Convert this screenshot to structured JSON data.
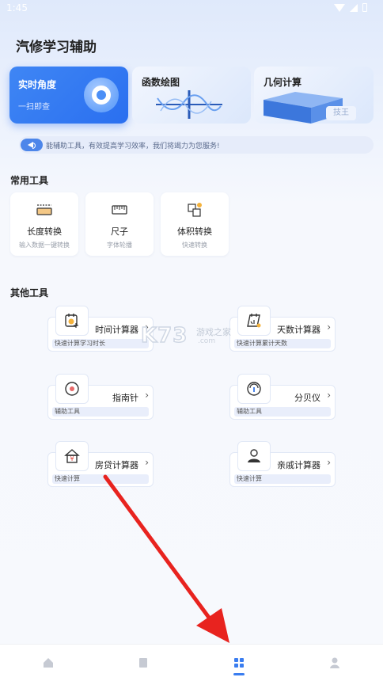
{
  "status_bar": {
    "time": "1:45"
  },
  "app": {
    "title": "汽修学习辅助"
  },
  "feature_cards": [
    {
      "title": "实时角度",
      "subtitle": "一扫即查"
    },
    {
      "title": "函数绘图"
    },
    {
      "title": "几何计算",
      "badge": "技王"
    }
  ],
  "notice": {
    "text": "能辅助工具，有效提高学习效率，我们将竭力为您服务!"
  },
  "common_tools": {
    "heading": "常用工具",
    "items": [
      {
        "name": "长度转换",
        "desc": "输入数据一键转换",
        "icon": "ruler-length-icon"
      },
      {
        "name": "尺子",
        "desc": "字体轮播",
        "icon": "ruler-icon"
      },
      {
        "name": "体积转换",
        "desc": "快速转换",
        "icon": "volume-icon"
      }
    ]
  },
  "other_tools": {
    "heading": "其他工具",
    "items": [
      {
        "name": "时间计算器",
        "desc": "快速计算学习时长",
        "icon": "calendar-clock-icon"
      },
      {
        "name": "天数计算器",
        "desc": "快速计算累计天数",
        "icon": "calendar-icon"
      },
      {
        "name": "指南针",
        "desc": "辅助工具",
        "icon": "compass-icon"
      },
      {
        "name": "分贝仪",
        "desc": "辅助工具",
        "icon": "decibel-meter-icon"
      },
      {
        "name": "房贷计算器",
        "desc": "快速计算",
        "icon": "house-loan-icon"
      },
      {
        "name": "亲戚计算器",
        "desc": "快速计算",
        "icon": "person-icon"
      }
    ]
  },
  "watermark": {
    "logo": "K73",
    "name": "游戏之家",
    "url": ".com"
  },
  "tabbar": {
    "items": [
      "home-icon",
      "book-icon",
      "grid-icon",
      "profile-icon"
    ],
    "active_index": 2
  },
  "colors": {
    "accent": "#3a7df0",
    "annotation_arrow": "#e8231f"
  }
}
